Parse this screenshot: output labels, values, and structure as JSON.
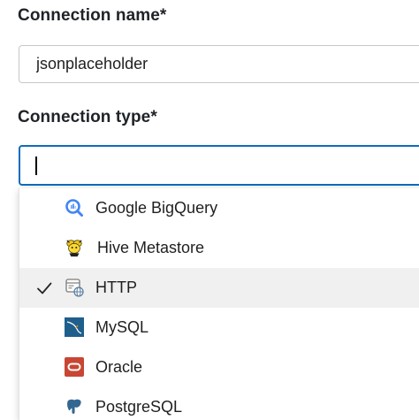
{
  "form": {
    "connection_name_label": "Connection name*",
    "connection_name_value": "jsonplaceholder",
    "connection_type_label": "Connection type*",
    "connection_type_value": ""
  },
  "dropdown": {
    "options": [
      {
        "label": "Google BigQuery",
        "icon": "google-bigquery-icon",
        "selected": false
      },
      {
        "label": "Hive Metastore",
        "icon": "hive-icon",
        "selected": false
      },
      {
        "label": "HTTP",
        "icon": "http-icon",
        "selected": true
      },
      {
        "label": "MySQL",
        "icon": "mysql-icon",
        "selected": false
      },
      {
        "label": "Oracle",
        "icon": "oracle-icon",
        "selected": false
      },
      {
        "label": "PostgreSQL",
        "icon": "postgresql-icon",
        "selected": false
      }
    ]
  },
  "colors": {
    "focus_border": "#0f6cbd",
    "selected_bg": "#f0f0f0",
    "oracle_red": "#c74634",
    "mysql_blue": "#1e5f8c",
    "bigquery_blue": "#4285f4",
    "hive_yellow": "#f5c518"
  }
}
